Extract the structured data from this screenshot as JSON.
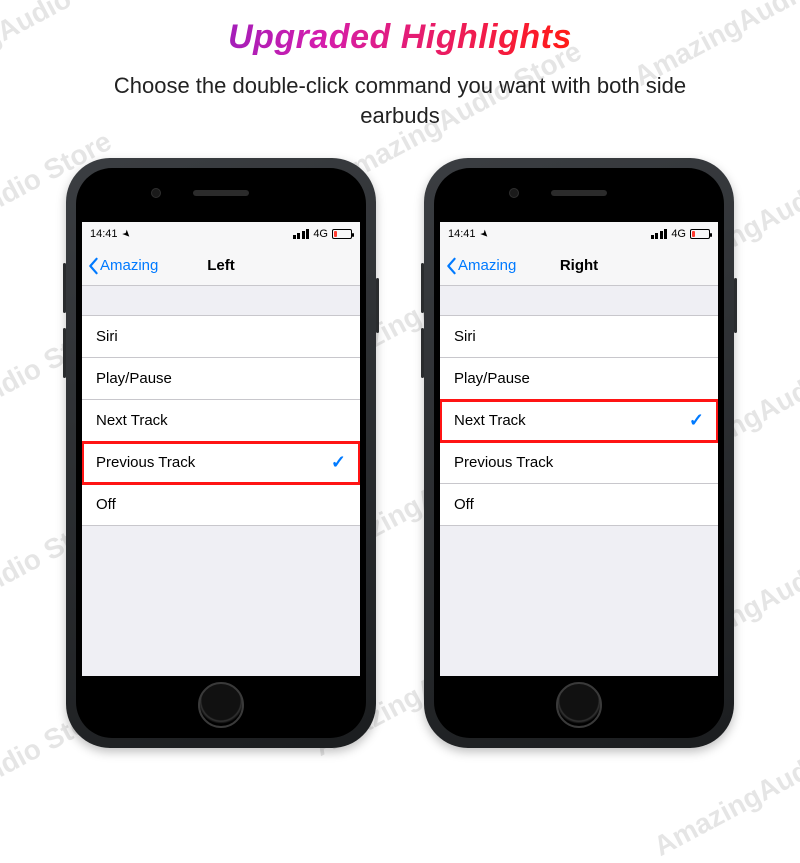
{
  "watermark": "AmazingAudio Store",
  "headline": "Upgraded Highlights",
  "subhead": "Choose the double-click command you want with both side earbuds",
  "status": {
    "time": "14:41",
    "net": "4G"
  },
  "nav": {
    "back": "Amazing"
  },
  "phones": [
    {
      "title": "Left",
      "options": [
        {
          "label": "Siri"
        },
        {
          "label": "Play/Pause"
        },
        {
          "label": "Next Track"
        },
        {
          "label": "Previous Track",
          "selected": true,
          "highlight": true
        },
        {
          "label": "Off"
        }
      ]
    },
    {
      "title": "Right",
      "options": [
        {
          "label": "Siri"
        },
        {
          "label": "Play/Pause"
        },
        {
          "label": "Next Track",
          "selected": true,
          "highlight": true
        },
        {
          "label": "Previous Track"
        },
        {
          "label": "Off"
        }
      ]
    }
  ]
}
